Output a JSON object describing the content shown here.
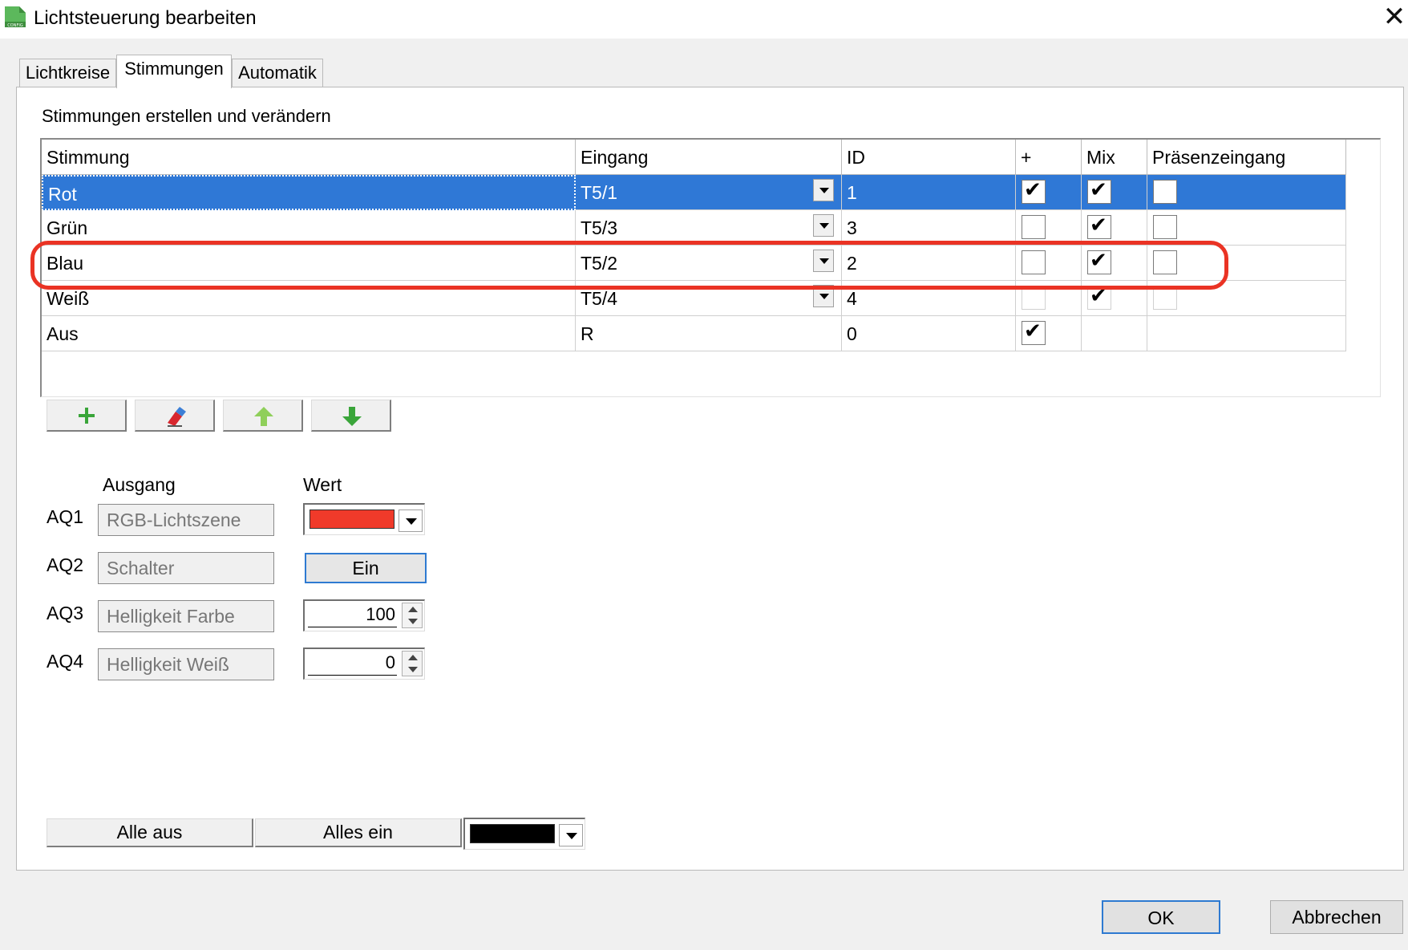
{
  "window": {
    "title": "Lichtsteuerung bearbeiten",
    "app_icon_label": "CONFIG",
    "accent": "#2f78d6"
  },
  "tabs": [
    {
      "label": "Lichtkreise",
      "active": false
    },
    {
      "label": "Stimmungen",
      "active": true
    },
    {
      "label": "Automatik",
      "active": false
    }
  ],
  "section_title": "Stimmungen erstellen und verändern",
  "table": {
    "columns": [
      "Stimmung",
      "Eingang",
      "ID",
      "+",
      "Mix",
      "Präsenzeingang"
    ],
    "rows": [
      {
        "stimmung": "Rot",
        "eingang": "T5/1",
        "id": "1",
        "plus": true,
        "mix": true,
        "praesenz": false,
        "selected": true
      },
      {
        "stimmung": "Grün",
        "eingang": "T5/3",
        "id": "3",
        "plus": false,
        "mix": true,
        "praesenz": false
      },
      {
        "stimmung": "Blau",
        "eingang": "T5/2",
        "id": "2",
        "plus": false,
        "mix": true,
        "praesenz": false,
        "highlighted": true
      },
      {
        "stimmung": "Weiß",
        "eingang": "T5/4",
        "id": "4",
        "plus": false,
        "mix": true,
        "praesenz": false
      },
      {
        "stimmung": "Aus",
        "eingang": "R",
        "id": "0",
        "plus": true,
        "mix": null,
        "praesenz": null
      }
    ]
  },
  "toolbar": [
    "add-icon",
    "eraser-icon",
    "move-up-icon",
    "move-down-icon"
  ],
  "outputs": {
    "header_ausgang": "Ausgang",
    "header_wert": "Wert",
    "items": [
      {
        "id": "AQ1",
        "ausgang": "RGB-Lichtszene",
        "wert_type": "color",
        "color": "#f03a2a"
      },
      {
        "id": "AQ2",
        "ausgang": "Schalter",
        "wert_type": "button",
        "value": "Ein"
      },
      {
        "id": "AQ3",
        "ausgang": "Helligkeit Farbe",
        "wert_type": "spinner",
        "value": "100"
      },
      {
        "id": "AQ4",
        "ausgang": "Helligkeit Weiß",
        "wert_type": "spinner",
        "value": "0"
      }
    ]
  },
  "bottom": {
    "alle_aus": "Alle aus",
    "alles_ein": "Alles ein",
    "color": "#000000"
  },
  "dialog": {
    "ok": "OK",
    "cancel": "Abbrechen"
  }
}
